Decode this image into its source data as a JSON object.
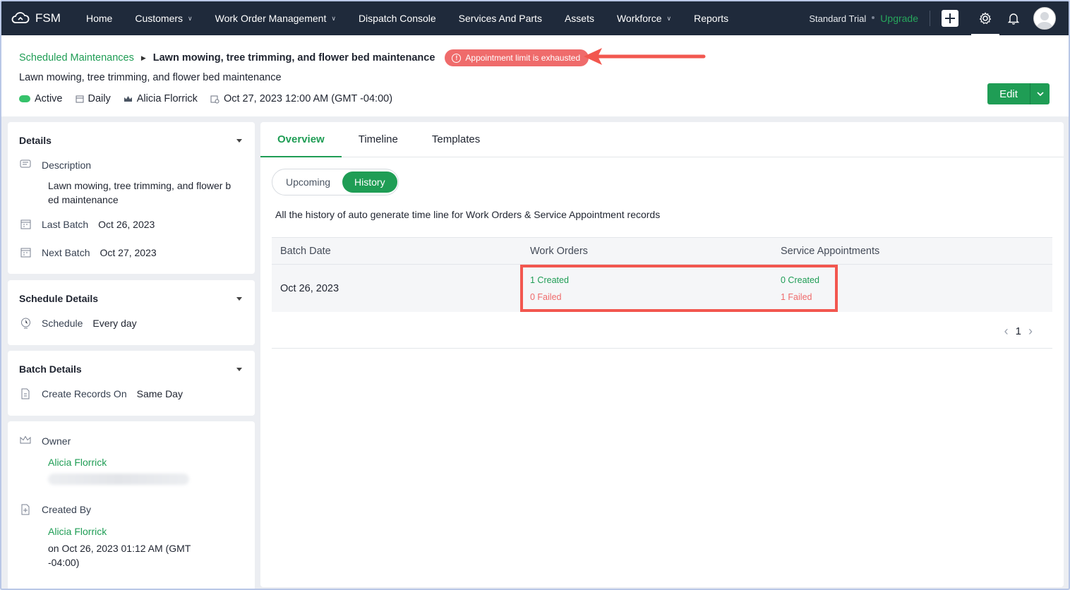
{
  "nav": {
    "logo": "FSM",
    "items": [
      {
        "label": "Home",
        "dropdown": false
      },
      {
        "label": "Customers",
        "dropdown": true
      },
      {
        "label": "Work Order Management",
        "dropdown": true
      },
      {
        "label": "Dispatch Console",
        "dropdown": false
      },
      {
        "label": "Services And Parts",
        "dropdown": false
      },
      {
        "label": "Assets",
        "dropdown": false
      },
      {
        "label": "Workforce",
        "dropdown": true
      },
      {
        "label": "Reports",
        "dropdown": false
      }
    ],
    "trial": "Standard Trial",
    "upgrade": "Upgrade"
  },
  "header": {
    "breadcrumb_parent": "Scheduled Maintenances",
    "breadcrumb_current": "Lawn mowing, tree trimming, and flower bed maintenance",
    "alert": "Appointment limit is exhausted",
    "title": "Lawn mowing, tree trimming, and flower bed maintenance",
    "status": "Active",
    "frequency": "Daily",
    "owner": "Alicia Florrick",
    "datetime": "Oct 27, 2023 12:00 AM (GMT -04:00)",
    "edit_label": "Edit"
  },
  "details": {
    "title": "Details",
    "description_label": "Description",
    "description_line1": "Lawn mowing, tree trimming, and flower b",
    "description_line2": "ed maintenance",
    "last_batch_label": "Last Batch",
    "last_batch_value": "Oct 26, 2023",
    "next_batch_label": "Next Batch",
    "next_batch_value": "Oct 27, 2023"
  },
  "schedule": {
    "title": "Schedule Details",
    "label": "Schedule",
    "value": "Every day"
  },
  "batch": {
    "title": "Batch Details",
    "label": "Create Records On",
    "value": "Same Day"
  },
  "owner_card": {
    "owner_label": "Owner",
    "owner_name": "Alicia Florrick",
    "created_by_label": "Created By",
    "created_by_name": "Alicia Florrick",
    "created_on_line1": "on Oct 26, 2023 01:12 AM (GMT",
    "created_on_line2": "-04:00)"
  },
  "tabs": [
    "Overview",
    "Timeline",
    "Templates"
  ],
  "toggle": {
    "upcoming": "Upcoming",
    "history": "History"
  },
  "history_desc": "All the history of auto generate time line for Work Orders & Service Appointment records",
  "table": {
    "headers": [
      "Batch Date",
      "Work Orders",
      "Service Appointments"
    ],
    "rows": [
      {
        "batch_date": "Oct 26, 2023",
        "wo_created": "1 Created",
        "wo_failed": "0 Failed",
        "sa_created": "0 Created",
        "sa_failed": "1 Failed"
      }
    ]
  },
  "pager": {
    "page": "1"
  },
  "colors": {
    "brand": "#1f9d55",
    "nav_bg": "#1f2a3b",
    "alert": "#ef6b6b",
    "annotation": "#f2574f"
  }
}
